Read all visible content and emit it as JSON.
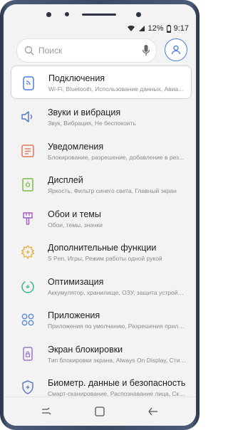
{
  "status": {
    "battery": "12%",
    "time": "9:17"
  },
  "search": {
    "placeholder": "Поиск"
  },
  "settings": [
    {
      "title": "Подключения",
      "subtitle": "Wi-Fi, Bluetooth, Использование данных, Авиа...",
      "icon": "connections-icon",
      "color": "#4a7bd6"
    },
    {
      "title": "Звуки и вибрация",
      "subtitle": "Звук, Вибрация, Не беспокоить",
      "icon": "sound-icon",
      "color": "#5b78c8"
    },
    {
      "title": "Уведомления",
      "subtitle": "Блокирование, разрешение, добавление в рез...",
      "icon": "notifications-icon",
      "color": "#e0795a"
    },
    {
      "title": "Дисплей",
      "subtitle": "Яркость, Фильтр синего света, Главный экран",
      "icon": "display-icon",
      "color": "#7bbd43"
    },
    {
      "title": "Обои и темы",
      "subtitle": "Обои, темы, значки",
      "icon": "themes-icon",
      "color": "#a45fc7"
    },
    {
      "title": "Дополнительные функции",
      "subtitle": "S Pen, Игры, Режим работы одной рукой",
      "icon": "advanced-features-icon",
      "color": "#e5b23b"
    },
    {
      "title": "Оптимизация",
      "subtitle": "Аккумулятор, хранилище, ОЗУ, защита устройства",
      "icon": "optimization-icon",
      "color": "#3bb38a"
    },
    {
      "title": "Приложения",
      "subtitle": "Приложения по умолчанию, Разрешения прило...",
      "icon": "apps-icon",
      "color": "#5b8ad6"
    },
    {
      "title": "Экран блокировки",
      "subtitle": "Тип блокировки экрана, Always On Display, Стиль...",
      "icon": "lock-screen-icon",
      "color": "#9b7bc9"
    },
    {
      "title": "Биометр. данные и безопасность",
      "subtitle": "Смарт-сканирование, Распознавание лица, Ска...",
      "icon": "security-icon",
      "color": "#5f7fc2"
    }
  ]
}
